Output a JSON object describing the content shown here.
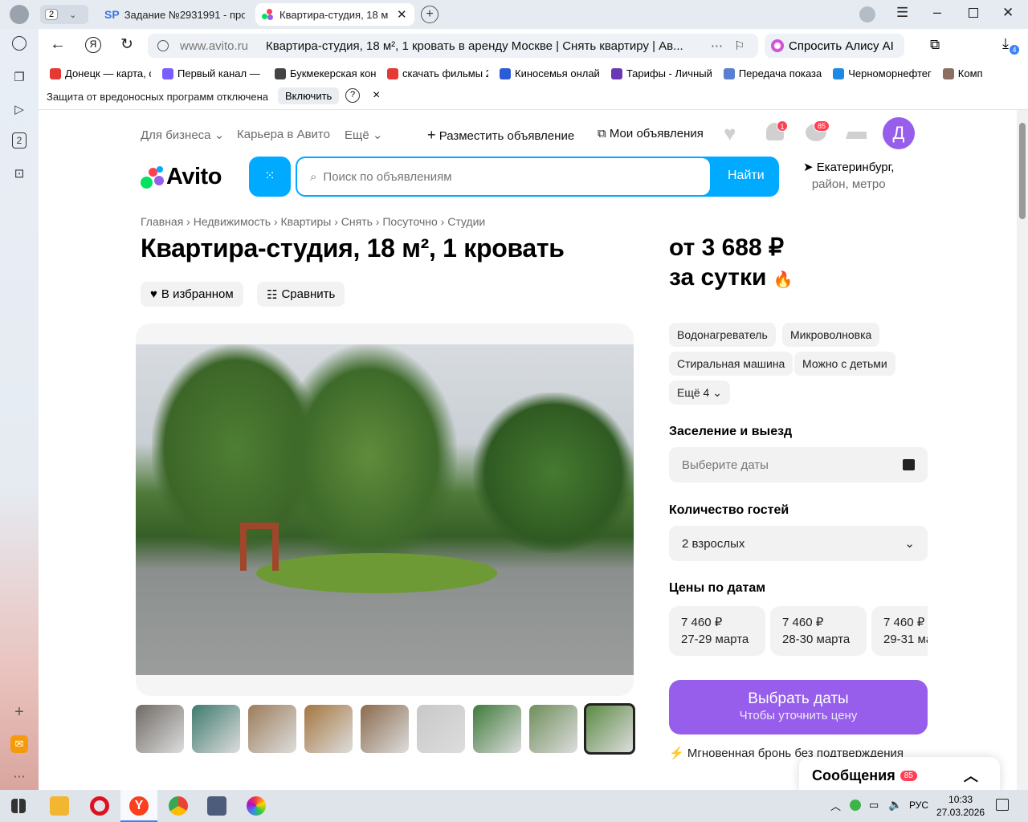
{
  "browser": {
    "tab_counter": "2",
    "tabs": [
      {
        "label": "Задание №2931991 - про",
        "favicon": "SP"
      },
      {
        "label": "Квартира-студия, 18 м"
      }
    ],
    "address": {
      "domain": "www.avito.ru",
      "title": "Квартира-студия, 18 м², 1 кровать в аренду Москве | Снять квартиру | Ав..."
    },
    "alice_label": "Спросить Алису AI",
    "downloads_badge": "4",
    "bookmarks": [
      "Донецк — карта, с",
      "Первый канал — с",
      "Букмекерская кон",
      "скачать фильмы 2",
      "Киносемья онлай",
      "Тарифы - Личный",
      "Передача показа",
      "Черноморнефтег",
      "Комп"
    ],
    "security_bar": {
      "text": "Защита от вредоносных программ отключена",
      "button": "Включить",
      "help": "?",
      "close": "×"
    },
    "sidebar_badge": "2"
  },
  "header": {
    "nav": [
      "Для бизнеса",
      "Карьера в Авито",
      "Ещё"
    ],
    "post_ad": "Разместить объявление",
    "my_ads": "Мои объявления",
    "notif_badge": "1",
    "msg_badge": "85",
    "avatar_letter": "Д",
    "logo": "Avito",
    "search_placeholder": "Поиск по объявлениям",
    "search_button": "Найти",
    "location": "Екатеринбург,",
    "location_sub": "район, метро"
  },
  "breadcrumbs": [
    "Главная",
    "Недвижимость",
    "Квартиры",
    "Снять",
    "Посуточно",
    "Студии"
  ],
  "listing": {
    "title": "Квартира-студия, 18 м², 1 кровать",
    "favorite": "В избранном",
    "compare": "Сравнить",
    "price": "от 3 688 ₽",
    "price_unit": "за сутки",
    "amenities": [
      "Водонагреватель",
      "Микроволновка",
      "Стиральная машина",
      "Можно с детьми"
    ],
    "more_amenities": "Ещё 4",
    "checkin_label": "Заселение и выезд",
    "dates_placeholder": "Выберите даты",
    "guests_label": "Количество гостей",
    "guests_value": "2 взрослых",
    "prices_label": "Цены по датам",
    "date_prices": [
      {
        "price": "7 460 ₽",
        "dates": "27-29 марта"
      },
      {
        "price": "7 460 ₽",
        "dates": "28-30 марта"
      },
      {
        "price": "7 460 ₽",
        "dates": "29-31 ма"
      }
    ],
    "cta_main": "Выбрать даты",
    "cta_sub": "Чтобы уточнить цену",
    "instant": "Мгновенная бронь без подтверждения",
    "thumbnail_count": 9
  },
  "messages_widget": {
    "label": "Сообщения",
    "badge": "85"
  },
  "taskbar": {
    "lang": "РУС",
    "time": "10:33",
    "date": "27.03.2026"
  },
  "colors": {
    "accent_blue": "#00aaff",
    "purple": "#965eeb",
    "badge_red": "#ff4053"
  }
}
